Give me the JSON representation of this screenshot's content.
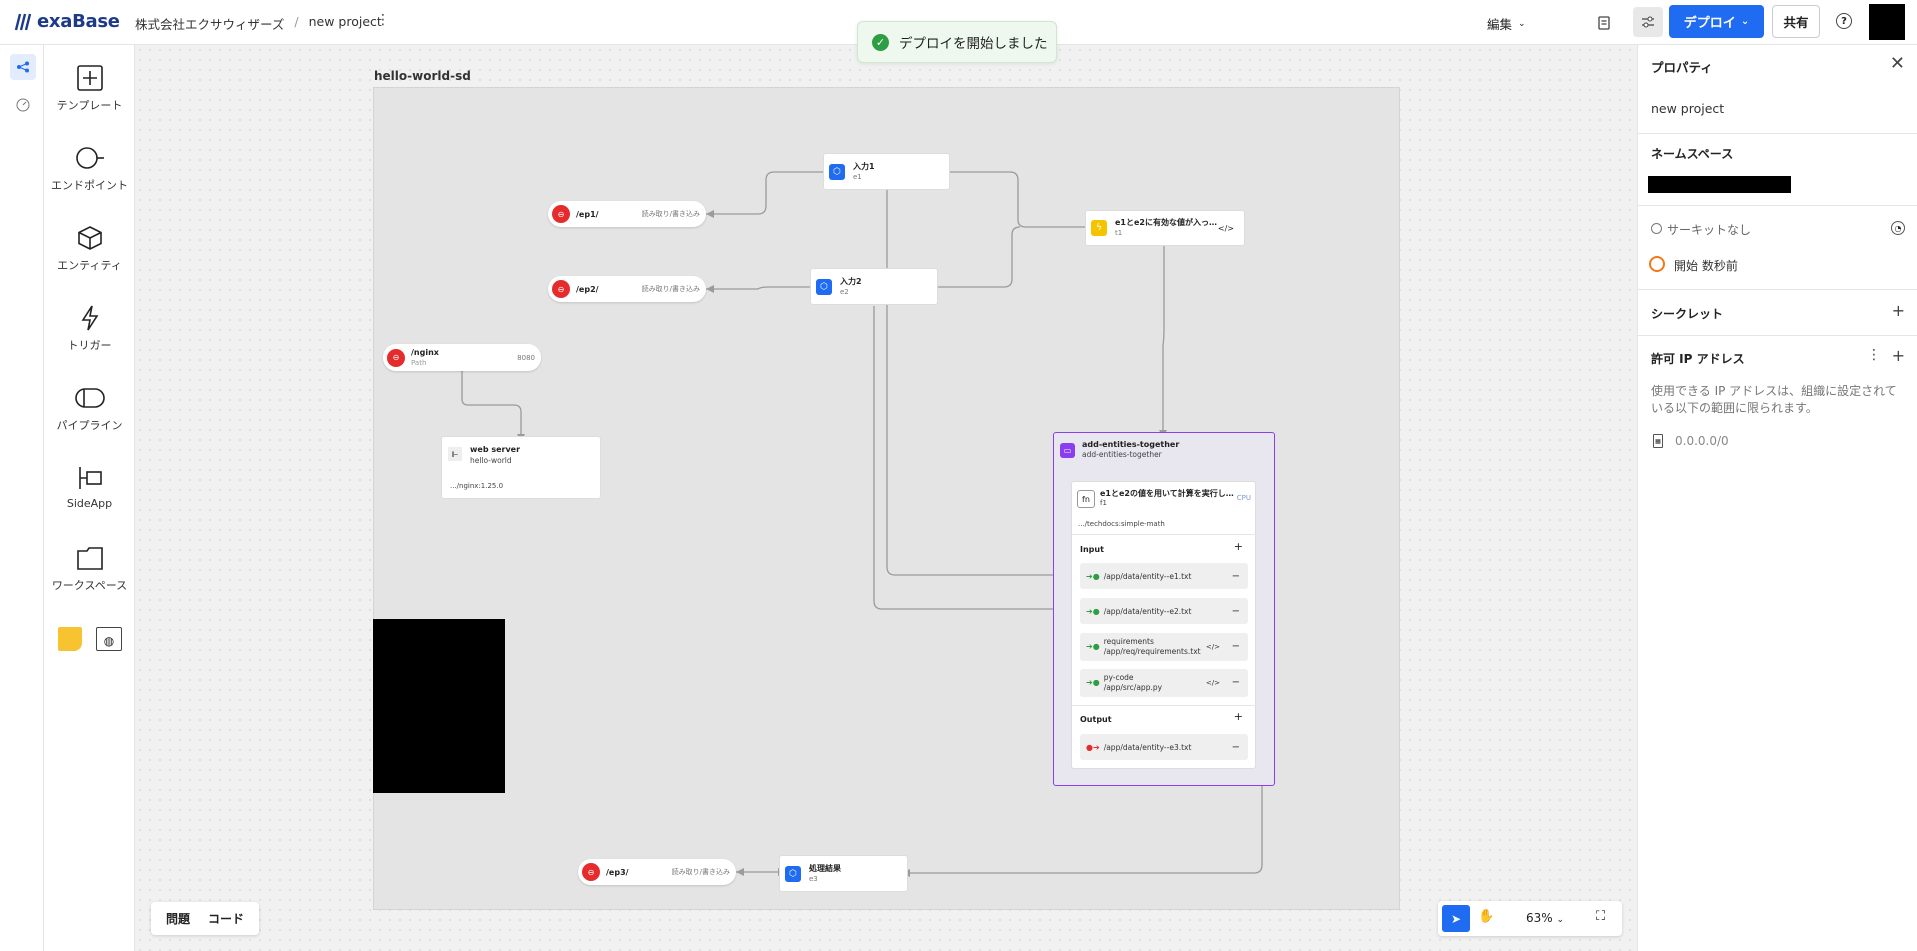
{
  "app": {
    "logo_text": "exaBase"
  },
  "breadcrumb": {
    "org": "株式会社エクサウィザーズ",
    "separator": "/",
    "project": "new project"
  },
  "toast": {
    "message": "デプロイを開始しました"
  },
  "toolbar": {
    "edit_label": "編集",
    "deploy_label": "デプロイ",
    "share_label": "共有",
    "help_label": "?"
  },
  "palette": {
    "items": [
      {
        "label": "テンプレート",
        "icon": "plus-square-icon"
      },
      {
        "label": "エンドポイント",
        "icon": "endpoint-icon"
      },
      {
        "label": "エンティティ",
        "icon": "cube-icon"
      },
      {
        "label": "トリガー",
        "icon": "lightning-icon"
      },
      {
        "label": "パイプライン",
        "icon": "pipeline-icon"
      },
      {
        "label": "SideApp",
        "icon": "sideapp-icon"
      },
      {
        "label": "ワークスペース",
        "icon": "workspace-icon"
      }
    ]
  },
  "canvas": {
    "group_label": "hello-world-sd",
    "endpoints": [
      {
        "path": "/ep1/",
        "mode": "読み取り/書き込み"
      },
      {
        "path": "/ep2/",
        "mode": "読み取り/書き込み"
      },
      {
        "path": "/nginx",
        "sub": "Path",
        "port": "8080"
      },
      {
        "path": "/ep3/",
        "mode": "読み取り/書き込み"
      }
    ],
    "entities": [
      {
        "title": "入力1",
        "sub": "e1"
      },
      {
        "title": "入力2",
        "sub": "e2"
      },
      {
        "title": "処理結果",
        "sub": "e3"
      }
    ],
    "trigger": {
      "title": "e1とe2に有効な値が入っ…",
      "sub": "t1"
    },
    "webserver": {
      "title": "web server",
      "sub": "hello-world",
      "image": ".../nginx:1.25.0"
    },
    "pipeline": {
      "title": "add-entities-together",
      "sub": "add-entities-together",
      "fn": {
        "title": "e1とe2の値を用いて計算を実行し…",
        "sub": "f1",
        "resource": "CPU",
        "image": ".../techdocs:simple-math"
      },
      "input_label": "Input",
      "inputs": [
        "/app/data/entity--e1.txt",
        "/app/data/entity--e2.txt"
      ],
      "files": [
        {
          "name": "requirements",
          "path": "/app/req/requirements.txt"
        },
        {
          "name": "py-code",
          "path": "/app/src/app.py"
        }
      ],
      "output_label": "Output",
      "outputs": [
        "/app/data/entity--e3.txt"
      ]
    }
  },
  "bottom": {
    "issues_label": "問題",
    "code_label": "コード",
    "zoom": "63%"
  },
  "properties": {
    "title": "プロパティ",
    "project_name": "new project",
    "namespace_label": "ネームスペース",
    "circuit_status": "サーキットなし",
    "start_status": "開始 数秒前",
    "secrets_label": "シークレット",
    "allowed_ip_label": "許可 IP アドレス",
    "allowed_ip_desc": "使用できる IP アドレスは、組織に設定されている以下の範囲に限られます。",
    "ip_range": "0.0.0.0/0"
  },
  "colors": {
    "accent": "#1f6bf2",
    "pipeline": "#8a3ef0",
    "endpoint": "#e52b2b",
    "trigger": "#f5c400",
    "success": "#2e9e45"
  }
}
